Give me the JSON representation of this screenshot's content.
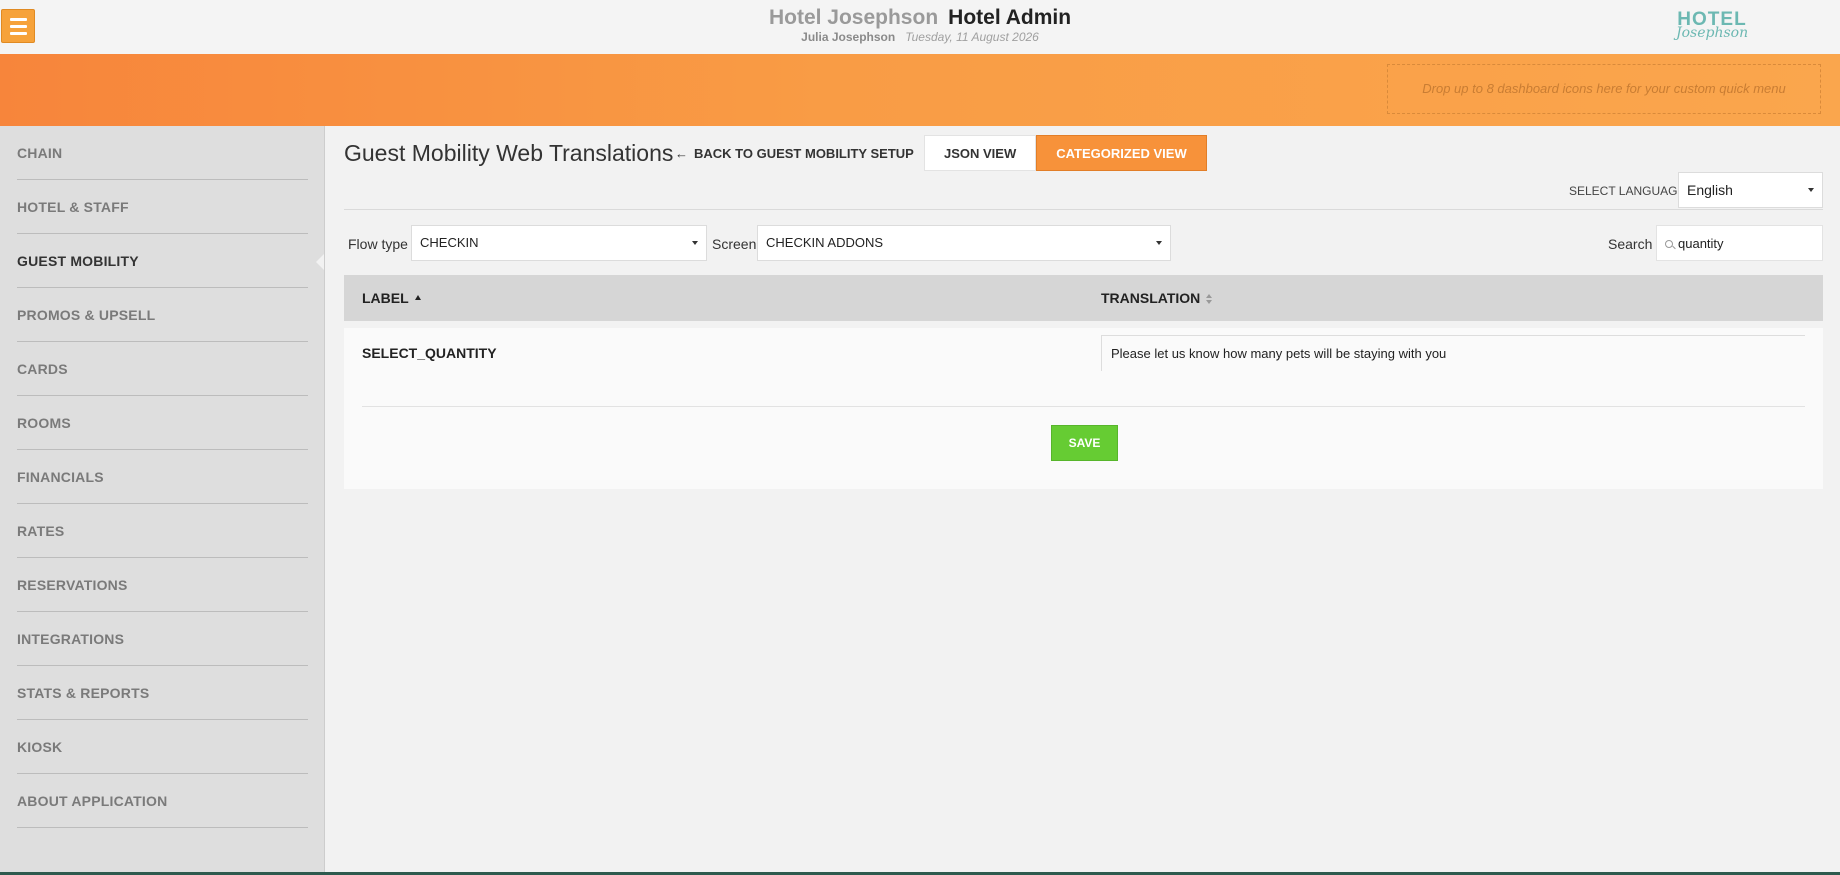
{
  "header": {
    "hotel_name": "Hotel Josephson",
    "app_name": "Hotel Admin",
    "user_name": "Julia Josephson",
    "date": "Tuesday, 11 August 2026",
    "logo_top": "HOTEL",
    "logo_bottom": "Josephson",
    "menu_icon": "hamburger-icon"
  },
  "banner": {
    "dropzone_text": "Drop up to 8 dashboard icons here for your custom quick menu"
  },
  "sidebar": {
    "items": [
      {
        "label": "CHAIN"
      },
      {
        "label": "HOTEL & STAFF"
      },
      {
        "label": "GUEST MOBILITY",
        "active": true
      },
      {
        "label": "PROMOS & UPSELL"
      },
      {
        "label": "CARDS"
      },
      {
        "label": "ROOMS"
      },
      {
        "label": "FINANCIALS"
      },
      {
        "label": "RATES"
      },
      {
        "label": "RESERVATIONS"
      },
      {
        "label": "INTEGRATIONS"
      },
      {
        "label": "STATS & REPORTS"
      },
      {
        "label": "KIOSK"
      },
      {
        "label": "ABOUT APPLICATION"
      }
    ]
  },
  "main": {
    "title": "Guest Mobility Web Translations",
    "back_link": "BACK TO GUEST MOBILITY SETUP",
    "view_json": "JSON VIEW",
    "view_categorized": "CATEGORIZED VIEW",
    "language_label": "SELECT LANGUAGE",
    "language_value": "English",
    "flow_label": "Flow type",
    "flow_value": "CHECKIN",
    "screen_label": "Screen",
    "screen_value": "CHECKIN ADDONS",
    "search_label": "Search",
    "search_value": "quantity"
  },
  "table": {
    "columns": {
      "label": "LABEL",
      "translation": "TRANSLATION"
    },
    "rows": [
      {
        "label": "SELECT_QUANTITY",
        "translation": "Please let us know how many pets will be staying with you"
      }
    ],
    "save_label": "SAVE"
  },
  "colors": {
    "accent_orange": "#f7923a",
    "save_green": "#66cc33",
    "logo_teal": "#6cb8b2"
  }
}
